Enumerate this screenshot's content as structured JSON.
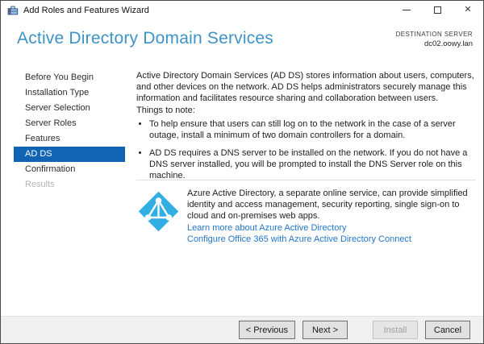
{
  "window": {
    "title": "Add Roles and Features Wizard"
  },
  "header": {
    "title": "Active Directory Domain Services",
    "destination_label": "DESTINATION SERVER",
    "destination_server": "dc02.oowy.lan"
  },
  "sidebar": {
    "items": [
      {
        "label": "Before You Begin",
        "state": "enabled"
      },
      {
        "label": "Installation Type",
        "state": "enabled"
      },
      {
        "label": "Server Selection",
        "state": "enabled"
      },
      {
        "label": "Server Roles",
        "state": "enabled"
      },
      {
        "label": "Features",
        "state": "enabled"
      },
      {
        "label": "AD DS",
        "state": "selected"
      },
      {
        "label": "Confirmation",
        "state": "enabled"
      },
      {
        "label": "Results",
        "state": "disabled"
      }
    ]
  },
  "content": {
    "intro": "Active Directory Domain Services (AD DS) stores information about users, computers, and other devices on the network.  AD DS helps administrators securely manage this information and facilitates resource sharing and collaboration between users.",
    "things_to_note": "Things to note:",
    "bullets": [
      "To help ensure that users can still log on to the network in the case of a server outage, install a minimum of two domain controllers for a domain.",
      "AD DS requires a DNS server to be installed on the network.  If you do not have a DNS server installed, you will be prompted to install the DNS Server role on this machine."
    ],
    "azure": {
      "icon": "azure-active-directory-icon",
      "description": "Azure Active Directory, a separate online service, can provide simplified identity and access management, security reporting, single sign-on to cloud and on-premises web apps.",
      "links": [
        "Learn more about Azure Active Directory",
        "Configure Office 365 with Azure Active Directory Connect"
      ]
    }
  },
  "footer": {
    "buttons": [
      {
        "label": "< Previous",
        "enabled": true
      },
      {
        "label": "Next >",
        "enabled": true
      },
      {
        "label": "Install",
        "enabled": false
      },
      {
        "label": "Cancel",
        "enabled": true
      }
    ]
  },
  "colors": {
    "heading_blue": "#3e93c6",
    "selected_item_bg": "#1164b4",
    "link_blue": "#2177cb",
    "azure_icon_blue": "#31afe3",
    "footer_bg": "#f0f0f0"
  }
}
